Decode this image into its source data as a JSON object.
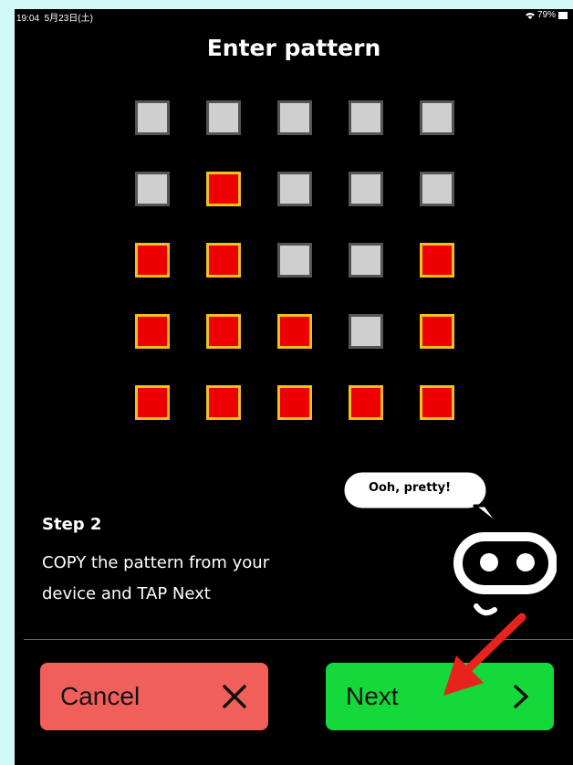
{
  "status_bar": {
    "time": "19:04",
    "date": "5月23日(土)",
    "battery": "79%"
  },
  "title": "Enter pattern",
  "pattern": [
    [
      0,
      0,
      0,
      0,
      0
    ],
    [
      0,
      1,
      0,
      0,
      0
    ],
    [
      1,
      1,
      0,
      0,
      1
    ],
    [
      1,
      1,
      1,
      0,
      1
    ],
    [
      1,
      1,
      1,
      1,
      1
    ]
  ],
  "colors": {
    "cell_on": "#ee0000",
    "cell_on_border": "#f0c020",
    "cell_off": "#cfcfcf",
    "cell_off_border": "#555555",
    "cancel_bg": "#f15f5b",
    "next_bg": "#15d83a",
    "annotation_arrow": "#e8231b"
  },
  "step": {
    "title": "Step 2",
    "line1": "COPY the pattern from your",
    "line2": "device and TAP Next"
  },
  "mascot": {
    "speech": "Ooh, pretty!"
  },
  "buttons": {
    "cancel": "Cancel",
    "next": "Next"
  },
  "icons": {
    "cancel": "close-icon",
    "next": "chevron-right-icon",
    "annotation": "red-arrow-icon"
  }
}
